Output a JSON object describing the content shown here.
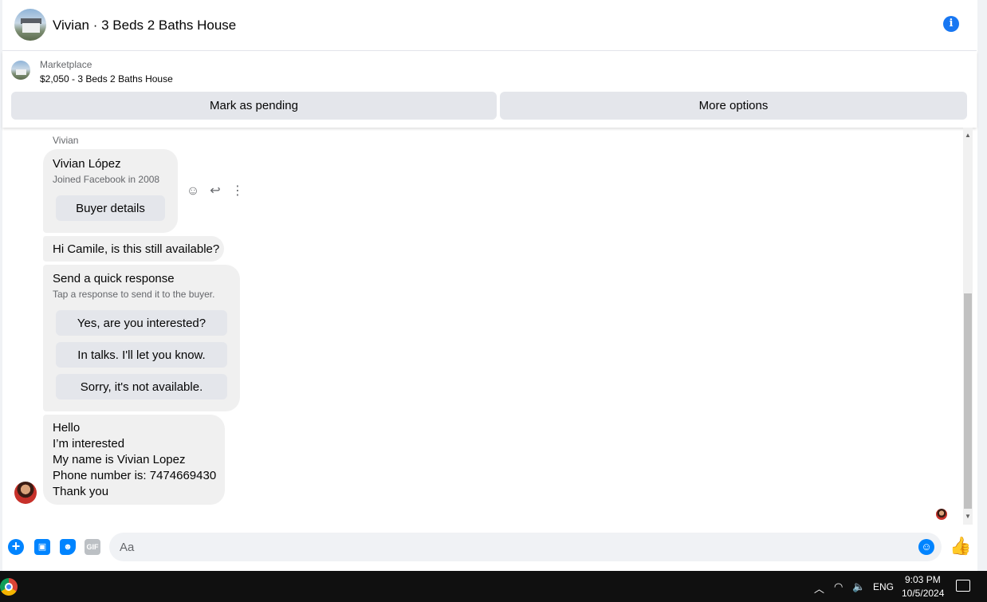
{
  "header": {
    "title": "Vivian · 3 Beds 2 Baths House",
    "info_icon": "info-icon",
    "info_glyph": "i"
  },
  "marketplace": {
    "label": "Marketplace",
    "listing": "$2,050 - 3 Beds 2 Baths House",
    "mark_pending": "Mark as pending",
    "more_options": "More options"
  },
  "messages": {
    "sender": "Vivian",
    "profile_card": {
      "name": "Vivian López",
      "joined": "Joined Facebook in 2008",
      "button": "Buyer details"
    },
    "greeting": "Hi Camile, is this still available?",
    "quick_response": {
      "title": "Send a quick response",
      "subtitle": "Tap a response to send it to the buyer.",
      "options": [
        "Yes, are you interested?",
        "In talks. I'll let you know.",
        "Sorry, it's not available."
      ]
    },
    "last_message": [
      "Hello",
      "I’m interested",
      "My name is Vivian Lopez",
      "Phone number is: 7474669430",
      "Thank you"
    ]
  },
  "hover_actions": {
    "react_glyph": "☺",
    "reply_glyph": "↩",
    "more_glyph": "⋮"
  },
  "composer": {
    "placeholder": "Aa",
    "gif_label": "GIF",
    "plus_glyph": "+",
    "emoji_glyph": "☺",
    "like_glyph": "👍"
  },
  "taskbar": {
    "language": "ENG",
    "time": "9:03 PM",
    "date": "10/5/2024"
  },
  "colors": {
    "accent": "#0084ff",
    "info_blue": "#1877f2",
    "bubble_gray": "#f0f0f0",
    "button_gray": "#e4e6eb"
  }
}
